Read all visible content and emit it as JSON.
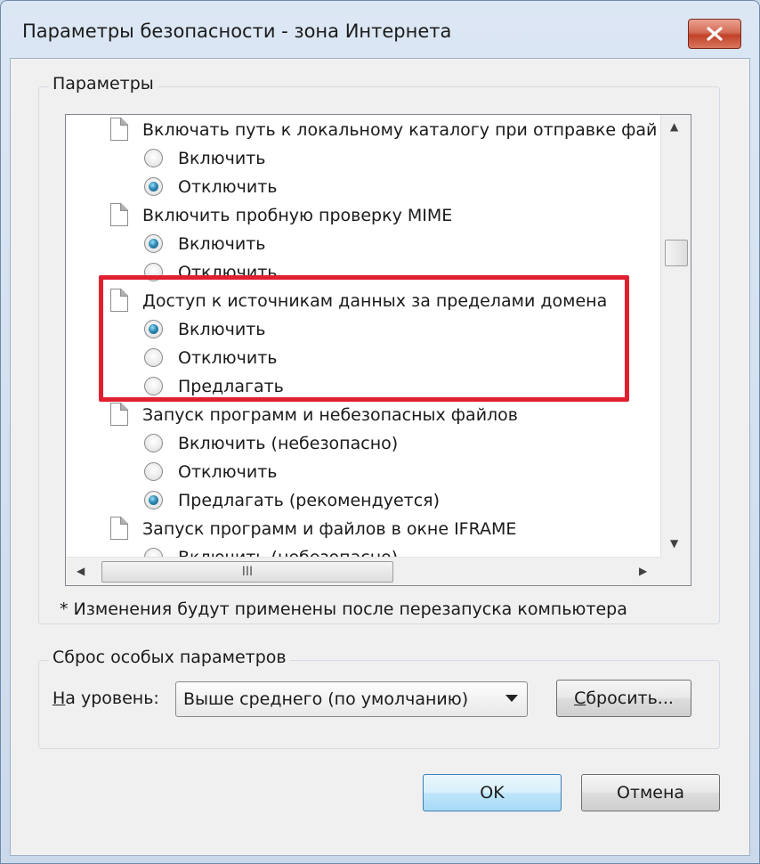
{
  "window": {
    "title": "Параметры безопасности - зона Интернета"
  },
  "settings_group": {
    "label": "Параметры"
  },
  "list_rows": [
    {
      "kind": "category",
      "text": "Включать путь к локальному каталогу при отправке фай"
    },
    {
      "kind": "option",
      "text": "Включить",
      "selected": false
    },
    {
      "kind": "option",
      "text": "Отключить",
      "selected": true
    },
    {
      "kind": "category",
      "text": "Включить пробную проверку MIME"
    },
    {
      "kind": "option",
      "text": "Включить",
      "selected": true
    },
    {
      "kind": "option",
      "text": "Отключить",
      "selected": false
    },
    {
      "kind": "category",
      "text": "Доступ к источникам данных за пределами домена"
    },
    {
      "kind": "option",
      "text": "Включить",
      "selected": true
    },
    {
      "kind": "option",
      "text": "Отключить",
      "selected": false
    },
    {
      "kind": "option",
      "text": "Предлагать",
      "selected": false
    },
    {
      "kind": "category",
      "text": "Запуск программ и небезопасных файлов"
    },
    {
      "kind": "option",
      "text": "Включить (небезопасно)",
      "selected": false
    },
    {
      "kind": "option",
      "text": "Отключить",
      "selected": false
    },
    {
      "kind": "option",
      "text": "Предлагать (рекомендуется)",
      "selected": true
    },
    {
      "kind": "category",
      "text": "Запуск программ и файлов в окне IFRAME"
    },
    {
      "kind": "option",
      "text": "Включить (небезопасно)",
      "selected": false
    }
  ],
  "hscroll": {
    "grip": "III"
  },
  "note": "* Изменения будут применены после перезапуска компьютера",
  "reset_group": {
    "label": "Сброс особых параметров",
    "level_label_accel": "Н",
    "level_label_rest": "а уровень:",
    "level_value": "Выше среднего (по умолчанию)",
    "reset_button_accel": "С",
    "reset_button_rest": "бросить..."
  },
  "buttons": {
    "ok": "OK",
    "cancel": "Отмена"
  },
  "colors": {
    "highlight": "#e02030",
    "close_button": "#c2412a"
  }
}
